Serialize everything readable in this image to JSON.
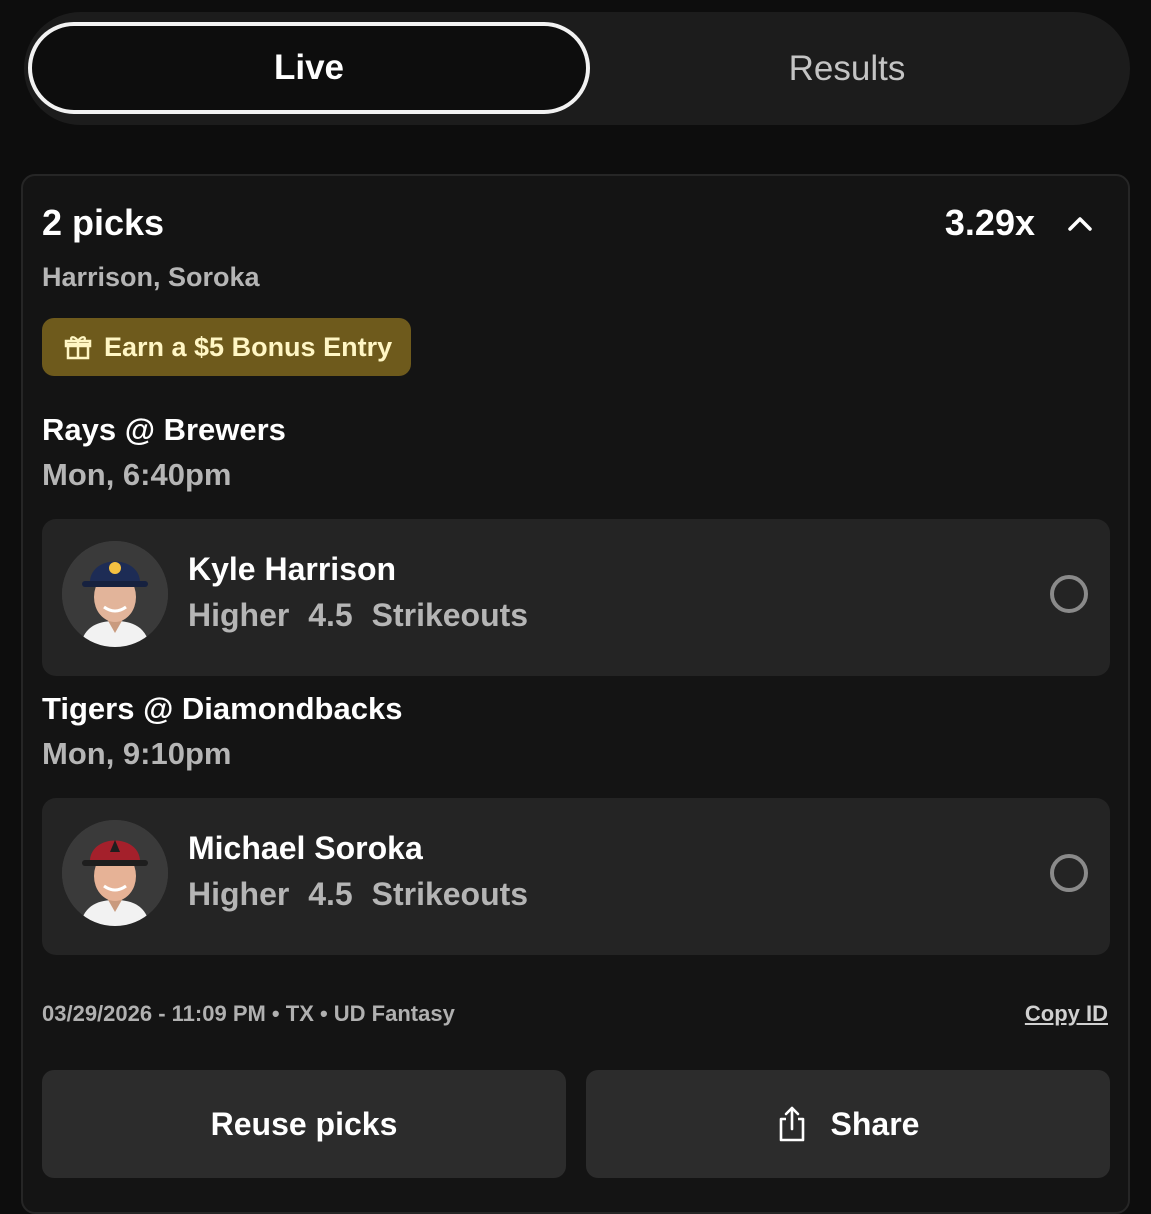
{
  "tabs": {
    "live": "Live",
    "results": "Results"
  },
  "entry": {
    "picks_label": "2 picks",
    "multiplier": "3.29x",
    "players_summary": "Harrison, Soroka",
    "bonus_label": "Earn a $5 Bonus Entry"
  },
  "games": [
    {
      "matchup": "Rays @ Brewers",
      "time": "Mon, 6:40pm",
      "pick": {
        "player": "Kyle Harrison",
        "direction": "Higher",
        "line": "4.5",
        "stat": "Strikeouts",
        "cap_color": "#1d2c55",
        "jersey_color": "#ffffff"
      }
    },
    {
      "matchup": "Tigers @ Diamondbacks",
      "time": "Mon, 9:10pm",
      "pick": {
        "player": "Michael Soroka",
        "direction": "Higher",
        "line": "4.5",
        "stat": "Strikeouts",
        "cap_color": "#a4202b",
        "jersey_color": "#ffffff"
      }
    }
  ],
  "footer": {
    "meta": "03/29/2026 - 11:09 PM • TX • UD Fantasy",
    "copy_id": "Copy ID"
  },
  "buttons": {
    "reuse": "Reuse picks",
    "share": "Share"
  },
  "icons": {
    "bonus": "gift-icon",
    "share": "share-icon",
    "collapse": "chevron-up-icon",
    "status": "pending-circle-icon"
  },
  "colors": {
    "bonus_bg": "#6e5a1c",
    "bonus_text": "#fff6c4",
    "background": "#0d0d0d"
  }
}
